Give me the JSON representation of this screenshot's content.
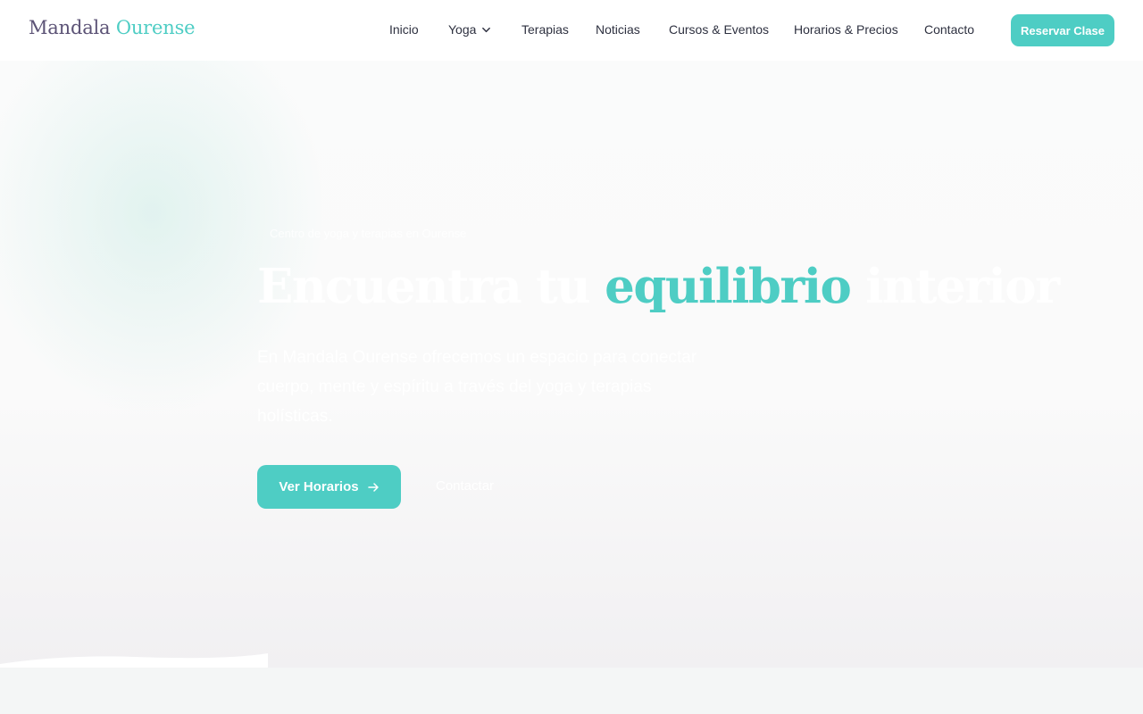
{
  "header": {
    "logo": {
      "part1": "Mandala",
      "part2": "Ourense"
    },
    "nav": [
      {
        "label": "Inicio"
      },
      {
        "label": "Yoga",
        "has_dropdown": true,
        "icon": "chevron-down-icon"
      },
      {
        "label": "Terapias"
      },
      {
        "label": "Noticias"
      },
      {
        "label": "Cursos & Eventos"
      },
      {
        "label": "Horarios & Precios"
      },
      {
        "label": "Contacto"
      }
    ],
    "cta_label": "Reservar Clase"
  },
  "hero": {
    "tagline": "Centro de yoga y terapias en Ourense",
    "headline": {
      "before": "Encuentra tu",
      "accent": "equilibrio",
      "after": "interior"
    },
    "subtitle": "En Mandala Ourense ofrecemos un espacio para conectar cuerpo, mente y espíritu a través del yoga y terapias holísticas.",
    "primary_button": {
      "label": "Ver Horarios",
      "icon": "arrow-right-icon"
    },
    "secondary_button": {
      "label": "Contactar"
    }
  },
  "colors": {
    "accent": "#4ecdc4",
    "logo_dark": "#5c5376",
    "nav_text": "#2e3140",
    "white": "#ffffff"
  }
}
